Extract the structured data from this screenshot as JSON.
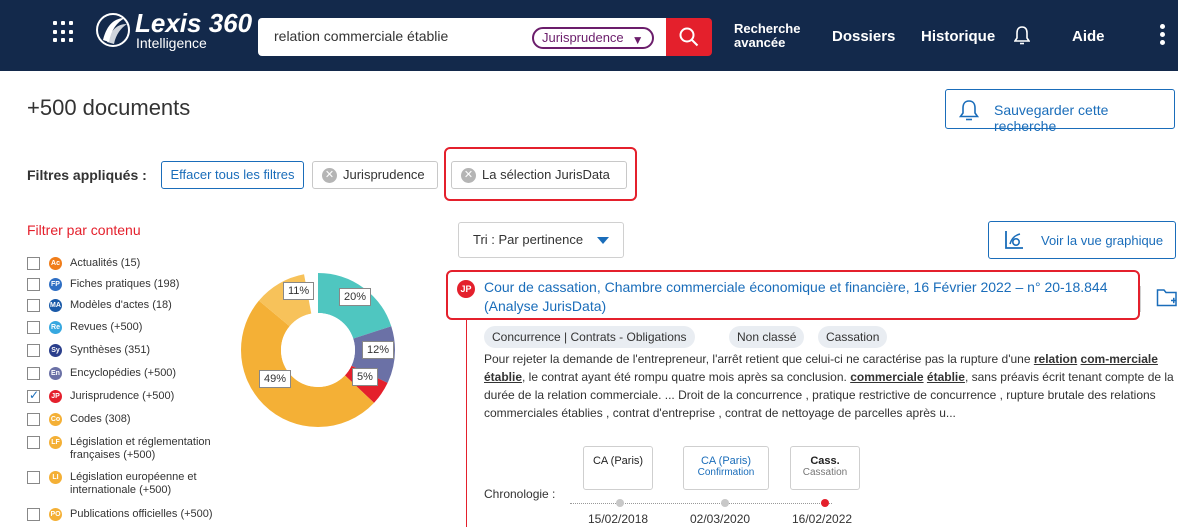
{
  "topbar": {
    "logo_main": "Lexis 360",
    "logo_sub": "Intelligence",
    "search_value": "relation commerciale établie",
    "scope_label": "Jurisprudence",
    "advanced_search_line1": "Recherche",
    "advanced_search_line2": "avancée",
    "nav_dossiers": "Dossiers",
    "nav_historique": "Historique",
    "nav_aide": "Aide"
  },
  "header": {
    "doc_count": "+500 documents",
    "save_search": "Sauvegarder cette recherche"
  },
  "filters_applied": {
    "label": "Filtres appliqués :",
    "clear_all": "Effacer tous les filtres",
    "chips": [
      "Jurisprudence",
      "La sélection JurisData"
    ]
  },
  "content_filter": {
    "heading": "Filtrer par contenu",
    "facets": [
      {
        "label": "Actualités (15)",
        "abbr": "Ac",
        "color": "#f07d1a",
        "checked": false
      },
      {
        "label": "Fiches pratiques (198)",
        "abbr": "FP",
        "color": "#2f6fc4",
        "checked": false
      },
      {
        "label": "Modèles d'actes (18)",
        "abbr": "MA",
        "color": "#1a5aa8",
        "checked": false
      },
      {
        "label": "Revues (+500)",
        "abbr": "Re",
        "color": "#37a8e0",
        "checked": false
      },
      {
        "label": "Synthèses (351)",
        "abbr": "Sy",
        "color": "#2b3f8c",
        "checked": false
      },
      {
        "label": "Encyclopédies (+500)",
        "abbr": "En",
        "color": "#6b71a6",
        "checked": false
      },
      {
        "label": "Jurisprudence (+500)",
        "abbr": "JP",
        "color": "#e4202c",
        "checked": true
      },
      {
        "label": "Codes (308)",
        "abbr": "Co",
        "color": "#f4b036",
        "checked": false
      },
      {
        "label": "Législation et réglementation",
        "label2": "françaises (+500)",
        "abbr": "LF",
        "color": "#f4b036",
        "checked": false
      },
      {
        "label": "Législation européenne et",
        "label2": "internationale (+500)",
        "abbr": "LI",
        "color": "#f4b036",
        "checked": false
      },
      {
        "label": "Publications officielles (+500)",
        "abbr": "PO",
        "color": "#f4b036",
        "checked": false
      }
    ],
    "donut": {
      "labels": [
        "20%",
        "12%",
        "5%",
        "49%",
        "11%"
      ],
      "colors": [
        "#4fc6c0",
        "#6b71a6",
        "#e4202c",
        "#f4b036",
        "#f4b036"
      ]
    }
  },
  "results": {
    "sort_label": "Tri : Par pertinence",
    "graph_view": "Voir la vue graphique",
    "item": {
      "badge": "JP",
      "title": "Cour de cassation, Chambre commerciale économique et financière, 16 Février 2022 – n° 20-18.844 (Analyse JurisData)",
      "tags": [
        "Concurrence | Contrats - Obligations",
        "Non classé",
        "Cassation"
      ],
      "snippet_parts": [
        "Pour rejeter la demande de l'entrepreneur, l'arrêt retient que celui-ci ne caractérise pas la rupture d'une ",
        "relation",
        " ",
        "com-merciale",
        " ",
        "établie",
        ", le contrat ayant été rompu quatre mois après sa conclusion. ",
        "commerciale",
        " ",
        "établie",
        ", sans préavis écrit tenant compte de la durée de la relation commerciale. ... Droit de la concurrence , pratique restrictive de concurrence , rupture brutale des relations commerciales établies , contrat d'entreprise , contrat de nettoyage de parcelles après u..."
      ],
      "chronology": {
        "label": "Chronologie :",
        "events": [
          {
            "court": "CA (Paris)",
            "type": "",
            "date": "15/02/2018"
          },
          {
            "court": "CA (Paris)",
            "type": "Confirmation",
            "date": "02/03/2020"
          },
          {
            "court": "Cass.",
            "type": "Cassation",
            "date": "16/02/2022"
          }
        ]
      }
    }
  }
}
